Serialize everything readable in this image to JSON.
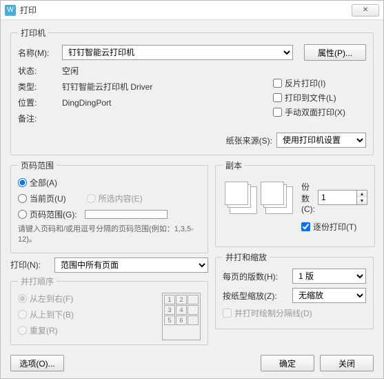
{
  "window": {
    "title": "打印",
    "close_glyph": "✕"
  },
  "printer_group": {
    "legend": "打印机",
    "name_label": "名称(M):",
    "name_value": "钉钉智能云打印机",
    "properties_btn": "属性(P)...",
    "status_label": "状态:",
    "status_value": "空闲",
    "type_label": "类型:",
    "type_value": "钉钉智能云打印机 Driver",
    "where_label": "位置:",
    "where_value": "DingDingPort",
    "comment_label": "备注:",
    "comment_value": "",
    "reverse_label": "反片打印(I)",
    "tofile_label": "打印到文件(L)",
    "duplex_label": "手动双面打印(X)",
    "paper_label": "纸张来源(S):",
    "paper_value": "使用打印机设置"
  },
  "range_group": {
    "legend": "页码范围",
    "all_label": "全部(A)",
    "current_label": "当前页(U)",
    "selection_label": "所选内容(E)",
    "pages_label": "页码范围(G):",
    "hint": "请键入页码和/或用逗号分隔的页码范围(例如：1,3,5-12)。"
  },
  "print_what": {
    "label": "打印(N):",
    "value": "范围中所有页面"
  },
  "order_group": {
    "legend": "并打顺序",
    "lr_label": "从左到右(F)",
    "tb_label": "从上到下(B)",
    "repeat_label": "重复(R)"
  },
  "copies_group": {
    "legend": "副本",
    "copies_label": "份数(C):",
    "copies_value": "1",
    "collate_label": "逐份打印(T)"
  },
  "zoom_group": {
    "legend": "并打和缩放",
    "perpage_label": "每页的版数(H):",
    "perpage_value": "1 版",
    "scale_label": "按纸型缩放(Z):",
    "scale_value": "无缩放",
    "separator_label": "并打时绘制分隔线(D)"
  },
  "footer": {
    "options_btn": "选项(O)...",
    "ok_btn": "确定",
    "close_btn": "关闭"
  }
}
